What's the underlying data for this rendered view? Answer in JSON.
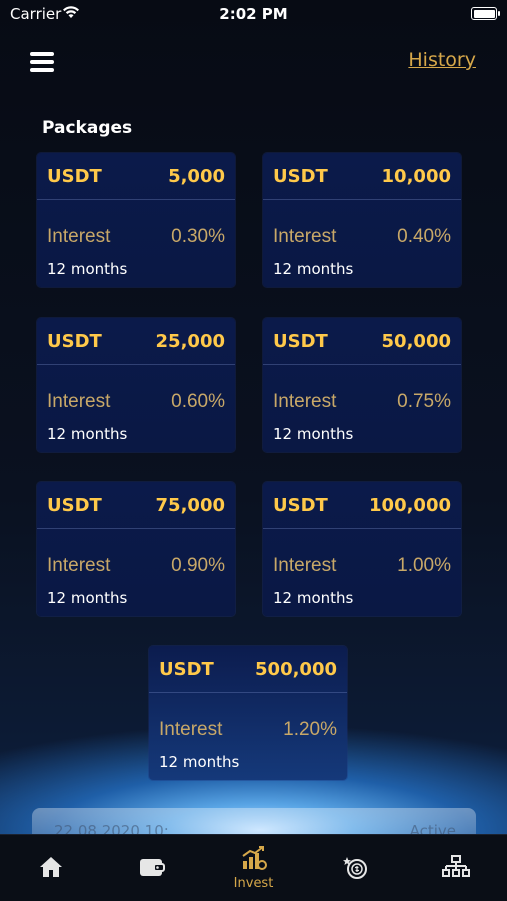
{
  "status_bar": {
    "carrier": "Carrier",
    "time": "2:02 PM"
  },
  "header": {
    "history_link": "History"
  },
  "section_title": "Packages",
  "packages": [
    {
      "currency": "USDT",
      "amount": "5,000",
      "interest_label": "Interest",
      "interest": "0.30%",
      "term": "12 months"
    },
    {
      "currency": "USDT",
      "amount": "10,000",
      "interest_label": "Interest",
      "interest": "0.40%",
      "term": "12 months"
    },
    {
      "currency": "USDT",
      "amount": "25,000",
      "interest_label": "Interest",
      "interest": "0.60%",
      "term": "12 months"
    },
    {
      "currency": "USDT",
      "amount": "50,000",
      "interest_label": "Interest",
      "interest": "0.75%",
      "term": "12 months"
    },
    {
      "currency": "USDT",
      "amount": "75,000",
      "interest_label": "Interest",
      "interest": "0.90%",
      "term": "12 months"
    },
    {
      "currency": "USDT",
      "amount": "100,000",
      "interest_label": "Interest",
      "interest": "1.00%",
      "term": "12 months"
    },
    {
      "currency": "USDT",
      "amount": "500,000",
      "interest_label": "Interest",
      "interest": "1.20%",
      "term": "12 months"
    }
  ],
  "background_row": {
    "date": "22.08.2020 10:",
    "status": "Active"
  },
  "tabs": [
    {
      "icon": "home-icon",
      "label": ""
    },
    {
      "icon": "wallet-icon",
      "label": ""
    },
    {
      "icon": "invest-icon",
      "label": "Invest",
      "active": true
    },
    {
      "icon": "coins-icon",
      "label": ""
    },
    {
      "icon": "network-icon",
      "label": ""
    }
  ],
  "colors": {
    "accent": "#ffc94a",
    "link": "#d6a84a",
    "card_bg": "#0b1a4a"
  }
}
